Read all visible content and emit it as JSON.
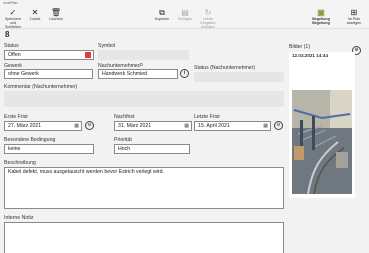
{
  "window": {
    "title": "mobiPlan"
  },
  "toolbar": {
    "save_close": "Speichern und Schließen",
    "back": "Zurück",
    "delete": "Löschen",
    "copy": "Kopieren",
    "paste": "Einfügen",
    "insert_last": "Letzte Eingaben einfügen",
    "plan_region": "Begehung Begehung",
    "open_plan": "Im Plan anzeigen"
  },
  "record": {
    "number": "8",
    "status_label": "Status",
    "status_value": "Offen",
    "status_color": "#e5393a",
    "symbol_label": "Symbol",
    "symbol_value": "",
    "trade_label": "Gewerk",
    "trade_value": "ohne Gewerk",
    "contractor_label": "Nachunternehmer",
    "contractor_value": "Handwerk Schmied",
    "contractor_status_label": "Status (Nachunternehmer)",
    "contractor_status_value": "",
    "comment_label": "Kommentar (Nachunternehmer)",
    "comment_value": "",
    "first_deadline_label": "Erste Frist",
    "first_deadline_value": "27. März 2021",
    "extension_label": "Nachfrist",
    "extension_value": "31. März 2021",
    "last_deadline_label": "Letzte Frist",
    "last_deadline_value": "15. April 2021",
    "special_label": "Besondere Bedingung",
    "special_value": "keine",
    "priority_label": "Priorität",
    "priority_value": "Hoch",
    "description_label": "Beschreibung",
    "description_value": "Kabel defekt, muss ausgetauscht werden bevor Estrich verlegt wird.",
    "internal_note_label": "Interne Notiz",
    "internal_note_value": ""
  },
  "photos": {
    "header": "Bilder (1)",
    "items": [
      {
        "timestamp": "12.03.2021 14:44"
      }
    ]
  },
  "icons": {
    "save": "checkmark-icon",
    "back": "x-close-icon",
    "delete": "trash-icon",
    "copy": "copy-icon",
    "paste": "clipboard-icon",
    "redo": "refresh-icon",
    "clipboard": "clipboard-highlight-icon",
    "map": "map-icon",
    "search": "search-icon",
    "info": "info-icon",
    "calendar": "calendar-icon",
    "add": "add-icon"
  }
}
